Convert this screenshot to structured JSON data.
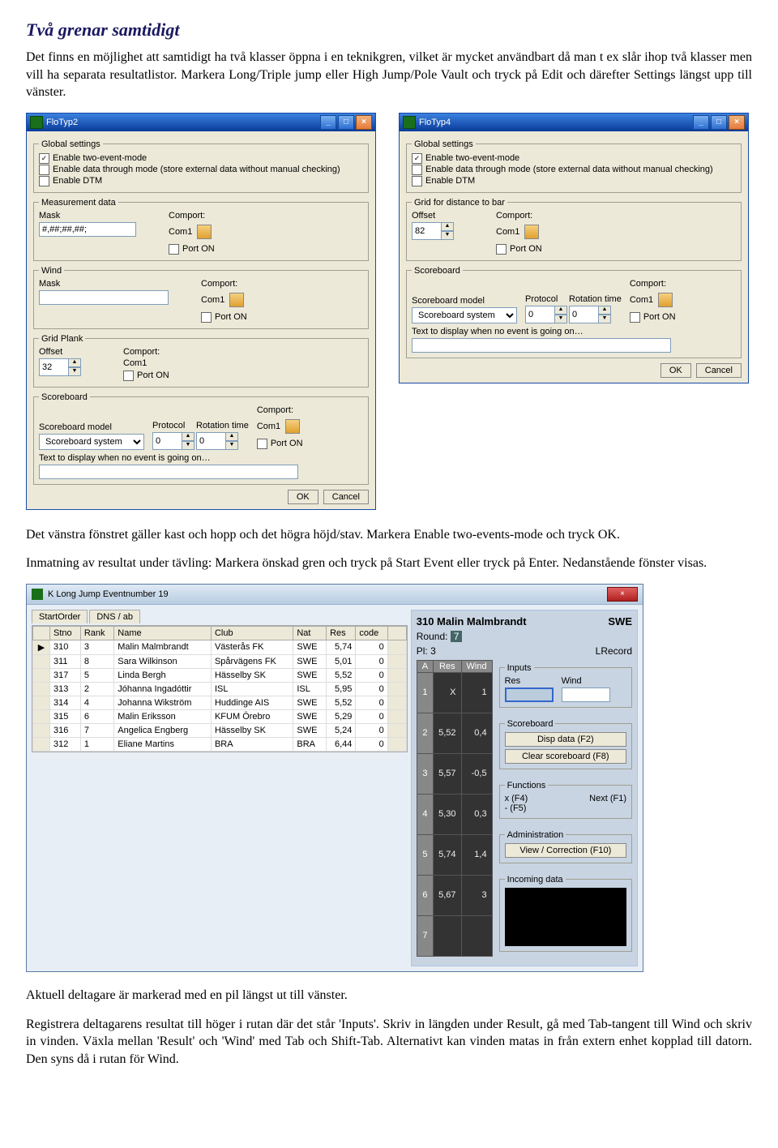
{
  "doc": {
    "heading": "Två grenar samtidigt",
    "p1": "Det finns en möjlighet att samtidigt ha två klasser öppna i en teknikgren, vilket är mycket användbart då man t ex slår ihop två klasser men vill ha separata resultatlistor. Markera Long/Triple jump eller High Jump/Pole Vault och tryck på Edit och därefter Settings längst upp till vänster.",
    "p2": "Det vänstra fönstret gäller kast och hopp och det högra höjd/stav. Markera Enable two-events-mode och tryck OK.",
    "p3": "Inmatning av resultat under tävling: Markera önskad gren och tryck på Start Event eller tryck på Enter. Nedanstående fönster visas.",
    "p4": "Aktuell deltagare är markerad med en pil längst ut till vänster.",
    "p5": "Registrera deltagarens resultat till höger i rutan där det står 'Inputs'. Skriv in längden under Result, gå med Tab-tangent till Wind och skriv in vinden. Växla mellan 'Result' och 'Wind' med Tab och Shift-Tab. Alternativt kan vinden matas in från extern enhet kopplad till datorn. Den syns då i rutan för Wind."
  },
  "winL": {
    "title": "FloTyp2",
    "legends": {
      "global": "Global settings",
      "meas": "Measurement data",
      "wind": "Wind",
      "gridplank": "Grid Plank",
      "scoreboard": "Scoreboard"
    },
    "chk1": "Enable two-event-mode",
    "chk2": "Enable data through mode (store external data without manual checking)",
    "chk3": "Enable DTM",
    "maskL": "Mask",
    "maskVal": "#,##;##,##;",
    "comportL": "Comport:",
    "comportVal": "Com1",
    "portonL": "Port ON",
    "offsetL": "Offset",
    "offsetVal": "32",
    "sbmodelL": "Scoreboard model",
    "sbmodelVal": "Scoreboard system",
    "protocolL": "Protocol",
    "protocolVal": "0",
    "rotL": "Rotation time",
    "rotVal": "0",
    "textL": "Text to display when no event is going on…",
    "ok": "OK",
    "cancel": "Cancel"
  },
  "winR": {
    "title": "FloTyp4",
    "legends": {
      "global": "Global settings",
      "gridbar": "Grid for distance to bar",
      "scoreboard": "Scoreboard"
    },
    "chk1": "Enable two-event-mode",
    "chk2": "Enable data through mode (store external data without manual checking)",
    "chk3": "Enable DTM",
    "offsetL": "Offset",
    "offsetVal": "82",
    "comportL": "Comport:",
    "comportVal": "Com1",
    "portonL": "Port ON",
    "sbmodelL": "Scoreboard model",
    "sbmodelVal": "Scoreboard system",
    "protocolL": "Protocol",
    "protocolVal": "0",
    "rotL": "Rotation time",
    "rotVal": "0",
    "textL": "Text to display when no event is going on…",
    "ok": "OK",
    "cancel": "Cancel"
  },
  "ev": {
    "title": "K Long Jump Eventnumber 19",
    "tabs": [
      "StartOrder",
      "DNS / ab"
    ],
    "headers": [
      "Stno",
      "Rank",
      "Name",
      "Club",
      "Nat",
      "Res",
      "code"
    ],
    "rows": [
      {
        "stno": "310",
        "rank": "3",
        "name": "Malin Malmbrandt",
        "club": "Västerås FK",
        "nat": "SWE",
        "res": "5,74",
        "code": "0",
        "selected": true
      },
      {
        "stno": "311",
        "rank": "8",
        "name": "Sara Wilkinson",
        "club": "Spårvägens FK",
        "nat": "SWE",
        "res": "5,01",
        "code": "0"
      },
      {
        "stno": "317",
        "rank": "5",
        "name": "Linda Bergh",
        "club": "Hässelby SK",
        "nat": "SWE",
        "res": "5,52",
        "code": "0"
      },
      {
        "stno": "313",
        "rank": "2",
        "name": "Jóhanna Ingadóttir",
        "club": "ISL",
        "nat": "ISL",
        "res": "5,95",
        "code": "0"
      },
      {
        "stno": "314",
        "rank": "4",
        "name": "Johanna Wikström",
        "club": "Huddinge AIS",
        "nat": "SWE",
        "res": "5,52",
        "code": "0"
      },
      {
        "stno": "315",
        "rank": "6",
        "name": "Malin Eriksson",
        "club": "KFUM Örebro",
        "nat": "SWE",
        "res": "5,29",
        "code": "0"
      },
      {
        "stno": "316",
        "rank": "7",
        "name": "Angelica Engberg",
        "club": "Hässelby SK",
        "nat": "SWE",
        "res": "5,24",
        "code": "0"
      },
      {
        "stno": "312",
        "rank": "1",
        "name": "Eliane Martins",
        "club": "BRA",
        "nat": "BRA",
        "res": "6,44",
        "code": "0"
      }
    ],
    "athlete": {
      "name": "310 Malin Malmbrandt",
      "nat": "SWE",
      "roundL": "Round:",
      "roundV": "7",
      "plL": "Pl:",
      "plV": "3",
      "lrecord": "LRecord"
    },
    "roundsH": [
      "A",
      "Res",
      "Wind"
    ],
    "rounds": [
      {
        "a": "1",
        "res": "X",
        "wind": "1"
      },
      {
        "a": "2",
        "res": "5,52",
        "wind": "0,4"
      },
      {
        "a": "3",
        "res": "5,57",
        "wind": "-0,5"
      },
      {
        "a": "4",
        "res": "5,30",
        "wind": "0,3"
      },
      {
        "a": "5",
        "res": "5,74",
        "wind": "1,4"
      },
      {
        "a": "6",
        "res": "5,67",
        "wind": "3"
      },
      {
        "a": "7",
        "res": "",
        "wind": ""
      }
    ],
    "inputsLeg": "Inputs",
    "inputsRes": "Res",
    "inputsWind": "Wind",
    "sbLeg": "Scoreboard",
    "dispData": "Disp data (F2)",
    "clearSb": "Clear scoreboard (F8)",
    "funcLeg": "Functions",
    "func1": "x  (F4)",
    "func2": "-  (F5)",
    "funcNext": "Next (F1)",
    "adminLeg": "Administration",
    "viewCorr": "View / Correction (F10)",
    "incomingLeg": "Incoming data"
  }
}
